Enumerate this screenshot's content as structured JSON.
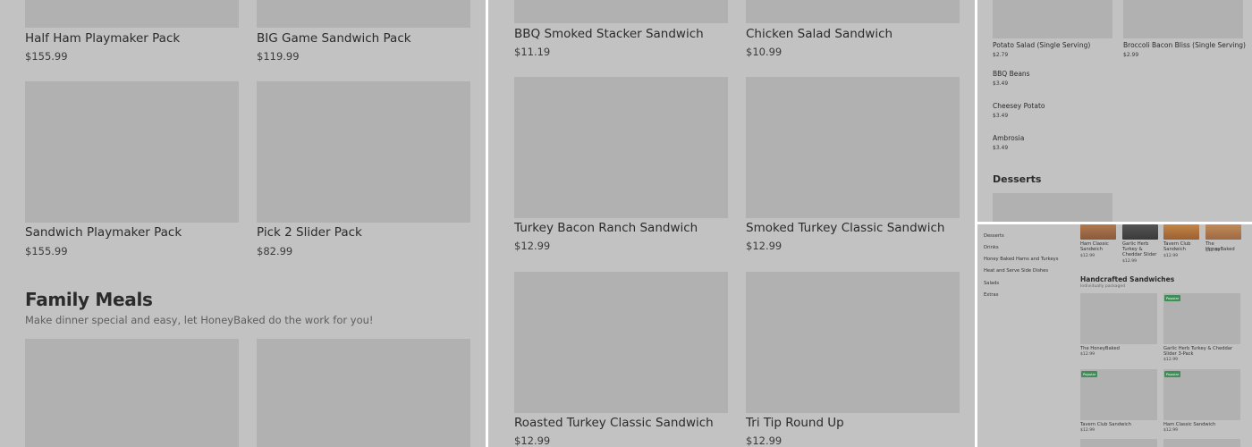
{
  "panel1": {
    "products_top": [
      {
        "name": "Half Ham Playmaker Pack",
        "price": "$155.99"
      },
      {
        "name": "BIG Game Sandwich Pack",
        "price": "$119.99"
      }
    ],
    "products_mid": [
      {
        "name": "Sandwich Playmaker Pack",
        "price": "$155.99"
      },
      {
        "name": "Pick 2 Slider Pack",
        "price": "$82.99"
      }
    ],
    "family_meals": {
      "title": "Family Meals",
      "subtitle": "Make dinner special and easy, let HoneyBaked do the work for you!"
    }
  },
  "panel2": {
    "products": [
      {
        "name": "BBQ Smoked Stacker Sandwich",
        "price": "$11.19"
      },
      {
        "name": "Chicken Salad Sandwich",
        "price": "$10.99"
      },
      {
        "name": "Turkey Bacon Ranch Sandwich",
        "price": "$12.99"
      },
      {
        "name": "Smoked Turkey Classic Sandwich",
        "price": "$12.99"
      },
      {
        "name": "Roasted Turkey Classic Sandwich",
        "price": "$12.99"
      },
      {
        "name": "Tri Tip Round Up",
        "price": "$12.99"
      }
    ]
  },
  "panel3": {
    "sides_top": [
      {
        "name": "Potato Salad (Single Serving)",
        "price": "$2.79"
      },
      {
        "name": "Broccoli Bacon Bliss (Single Serving)",
        "price": "$2.99"
      }
    ],
    "sides_list": [
      {
        "name": "BBQ Beans",
        "price": "$3.49"
      },
      {
        "name": "Cheesey Potato",
        "price": "$3.49"
      },
      {
        "name": "Ambrosia",
        "price": "$3.49"
      }
    ],
    "desserts_title": "Desserts"
  },
  "panel4": {
    "nav": [
      "Desserts",
      "Drinks",
      "Honey Baked Hams and Turkeys",
      "Heat and Serve Side Dishes",
      "Salads",
      "Extras"
    ],
    "featured": [
      {
        "name": "Ham Classic Sandwich",
        "price": "$12.99"
      },
      {
        "name": "Garlic Herb Turkey & Cheddar Slider",
        "price": "$12.99"
      },
      {
        "name": "Tavern Club Sandwich",
        "price": "$12.99"
      },
      {
        "name": "The HoneyBaked",
        "price": "$12.99"
      }
    ],
    "section_title": "Handcrafted Sandwiches",
    "section_subtitle": "Individually packaged",
    "badge_label": "Popular",
    "grid": [
      {
        "name": "The HoneyBaked",
        "price": "$12.99"
      },
      {
        "name": "Garlic Herb Turkey & Cheddar Slider 3-Pack",
        "price": "$12.99"
      },
      {
        "name": "Tavern Club Sandwich",
        "price": "$12.99"
      },
      {
        "name": "Ham Classic Sandwich",
        "price": "$12.99"
      }
    ]
  },
  "colors": {
    "overlay": "#c2c2c2",
    "image_placeholder": "#b1b1b1",
    "badge_green": "#3f8d57"
  }
}
